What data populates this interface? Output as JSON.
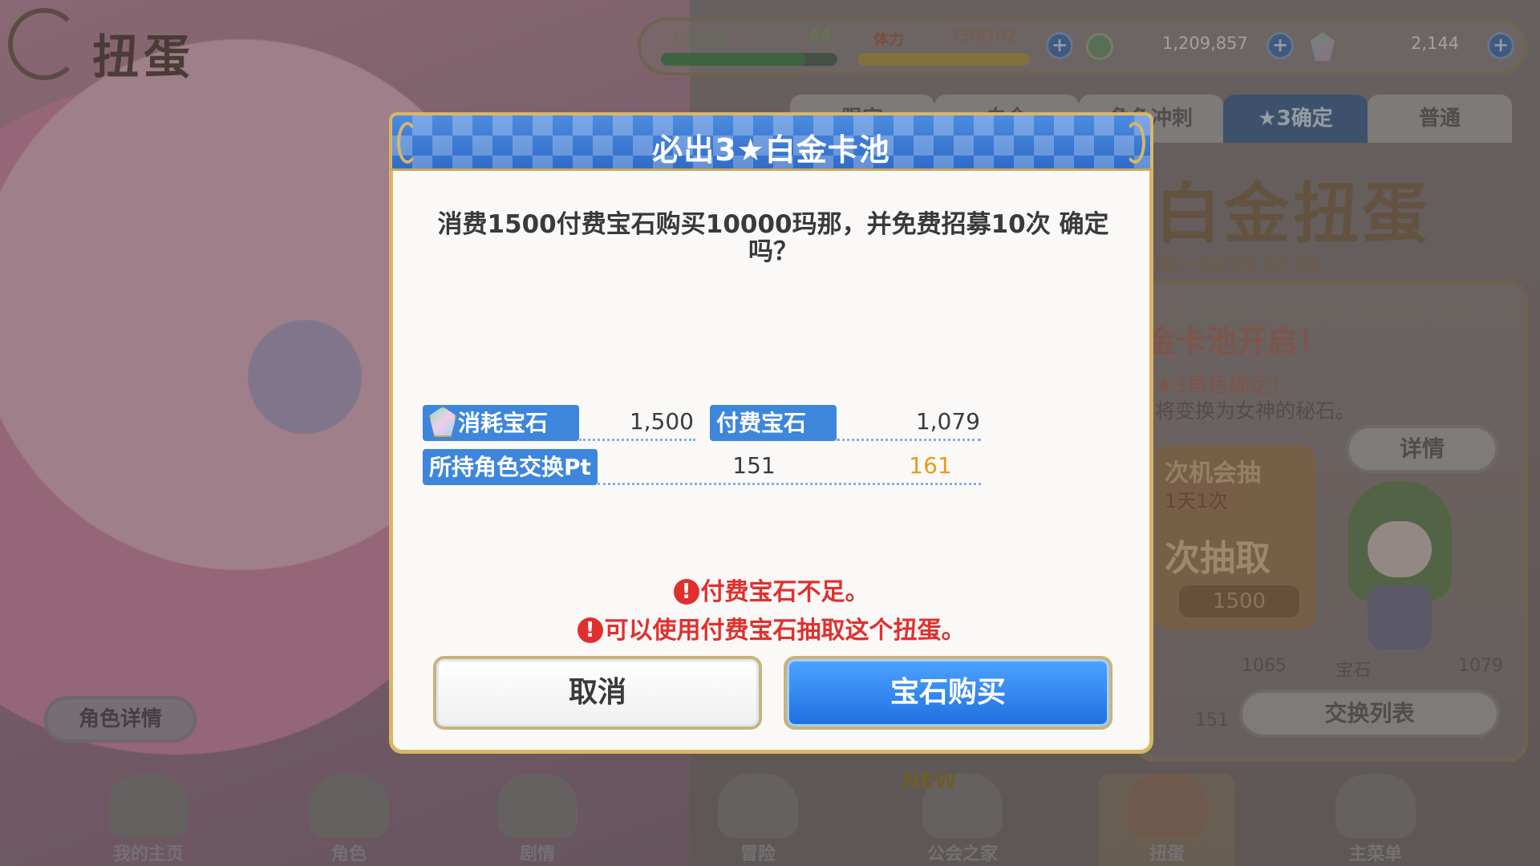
{
  "background": {
    "page_title": "扭蛋",
    "status": {
      "level_label": "玩家等级",
      "level_value": "44",
      "level_progress": 0.82,
      "stamina_label": "体力",
      "stamina_value": "730/102",
      "stamina_progress": 1.0,
      "mana": "1,209,857",
      "gems": "2,144"
    },
    "tabs": [
      "限定",
      "白金",
      "角色冲刺",
      "★3确定",
      "普通"
    ],
    "active_tab_index": 3,
    "banner": {
      "title": "白金扭蛋",
      "date": "00~04/29 12:59",
      "line1": "金卡池开启！",
      "line2": "★3角色确定！",
      "line3": "将变换为女神的秘石。",
      "detail_button": "详情",
      "free_card_line1": "次机会抽",
      "free_card_line2": "1天1次",
      "free_card_line3": "次抽取",
      "free_card_price": "1500",
      "num_left": "1065",
      "gem_label": "宝石",
      "num_right": "1079",
      "num_pt": "151",
      "exchange_button": "交换列表"
    },
    "char_detail_button": "角色详情",
    "nav": [
      "我的主页",
      "角色",
      "剧情",
      "冒险",
      "公会之家",
      "扭蛋",
      "主菜单"
    ],
    "nav_new_badge": "NEW",
    "active_nav_index": 5
  },
  "modal": {
    "title": "必出3★白金卡池",
    "message": "消费1500付费宝石购买10000玛那，并免费招募10次 确定吗？",
    "rows": {
      "consume_label": "消耗宝石",
      "consume_value": "1,500",
      "paid_label": "付费宝石",
      "paid_value": "1,079",
      "pt_label": "所持角色交换Pt",
      "pt_current": "151",
      "pt_after": "161"
    },
    "warnings": [
      "付费宝石不足。",
      "可以使用付费宝石抽取这个扭蛋。"
    ],
    "warning_glyph": "!",
    "cancel_label": "取消",
    "buy_label": "宝石购买"
  },
  "colors": {
    "accent_blue": "#3e86dc",
    "warning_red": "#e0302e",
    "highlight_orange": "#e89a1a",
    "gold_border": "#d9b667"
  }
}
